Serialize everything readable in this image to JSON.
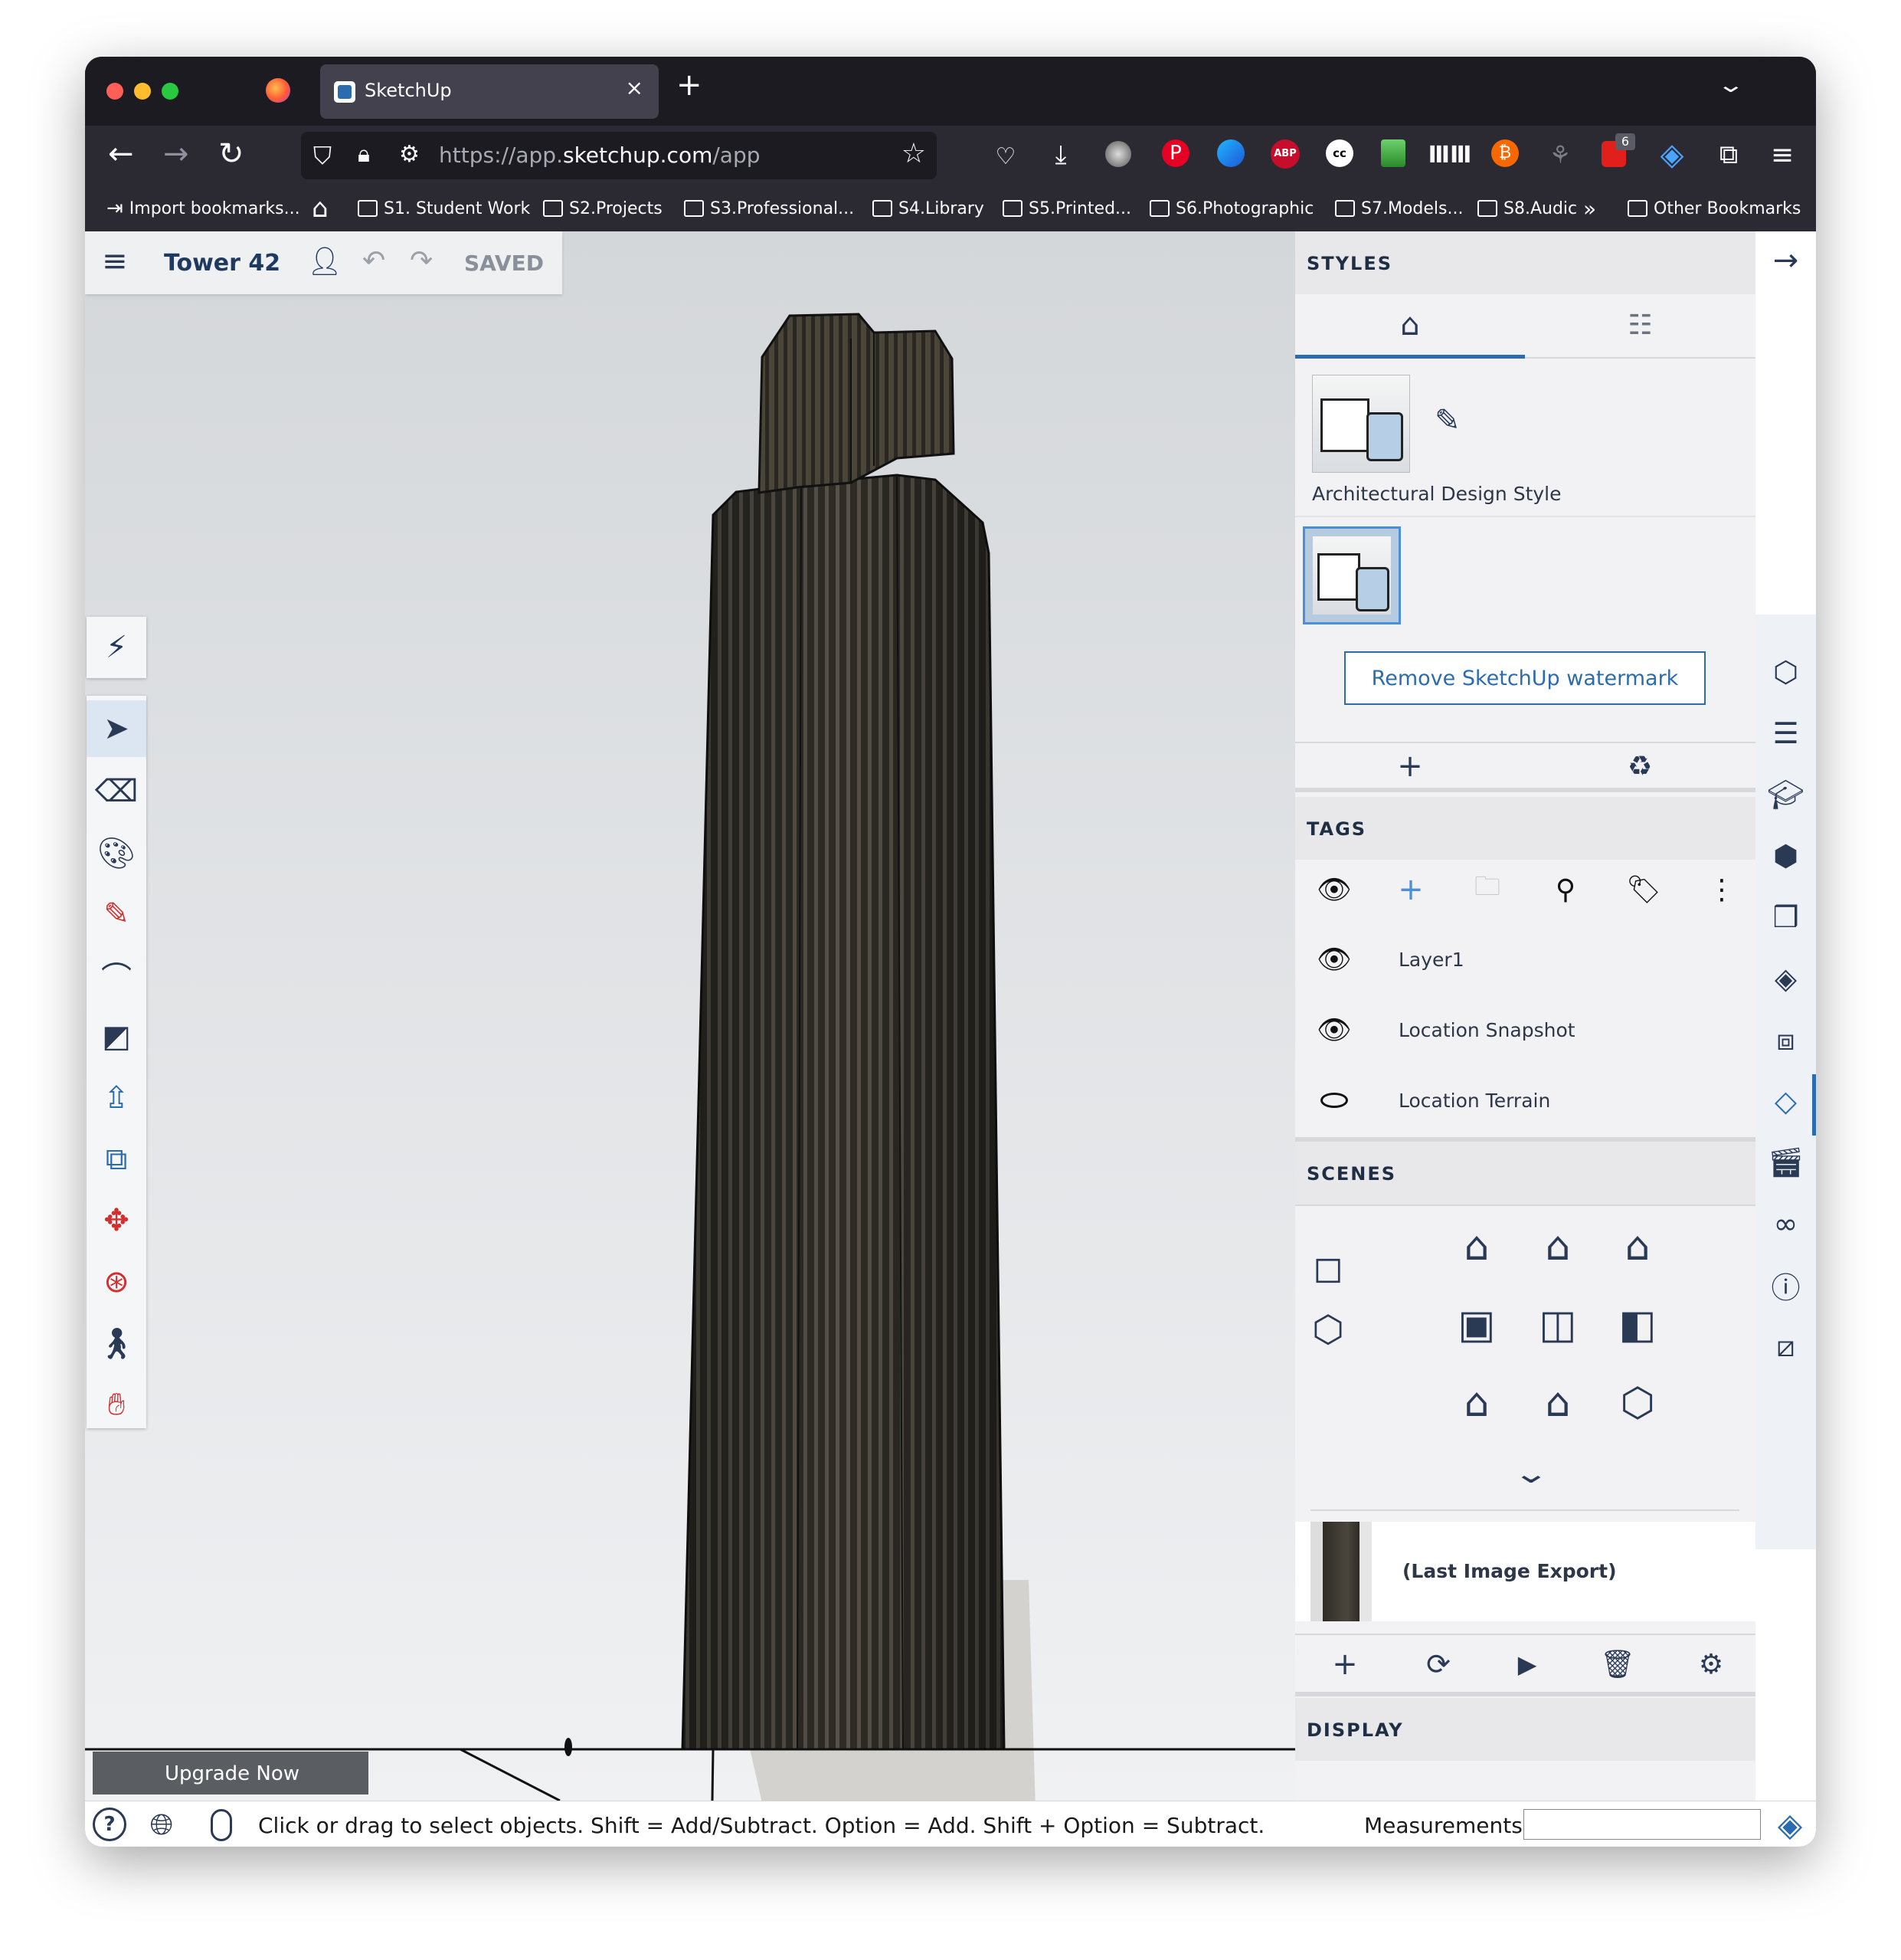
{
  "browser": {
    "tab_title": "SketchUp",
    "url_prefix": "https://app.",
    "url_domain": "sketchup.com",
    "url_path": "/app",
    "badge_count": "6",
    "bookmarks": [
      "Import bookmarks...",
      "S1. Student Work",
      "S2.Projects",
      "S3.Professional...",
      "S4.Library",
      "S5.Printed...",
      "S6.Photographic",
      "S7.Models...",
      "S8.Audic",
      "Other Bookmarks"
    ]
  },
  "app": {
    "file_title": "Tower 42",
    "save_status": "SAVED",
    "upgrade_label": "Upgrade Now"
  },
  "styles": {
    "header": "STYLES",
    "style_name": "Architectural Design Style",
    "watermark_button": "Remove SketchUp watermark"
  },
  "tags": {
    "header": "TAGS",
    "items": [
      {
        "name": "Layer1",
        "visible": true
      },
      {
        "name": "Location Snapshot",
        "visible": true
      },
      {
        "name": "Location Terrain",
        "visible": false
      }
    ]
  },
  "scenes": {
    "header": "SCENES",
    "scene_name": "(Last Image Export)"
  },
  "display": {
    "header": "DISPLAY"
  },
  "status": {
    "hint": "Click or drag to select objects. Shift = Add/Subtract. Option = Add. Shift + Option = Subtract.",
    "measurements_label": "Measurements",
    "measurements_value": ""
  },
  "colors": {
    "accent": "#2b6cb0",
    "brand": "#1f3a5f",
    "danger": "#d32f2f"
  }
}
